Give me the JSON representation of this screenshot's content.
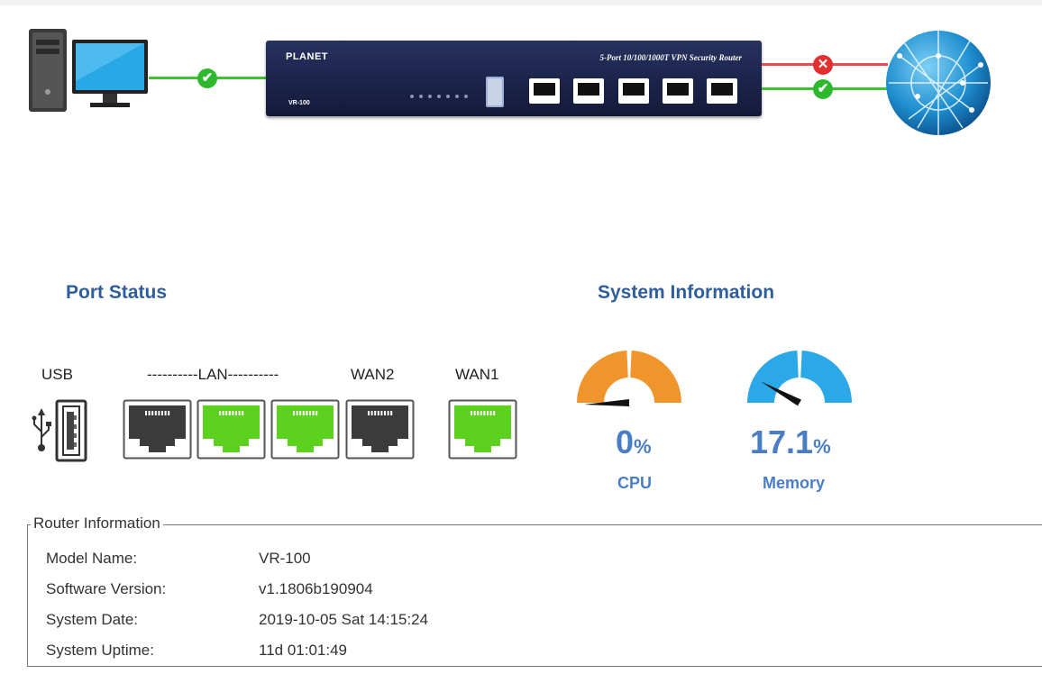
{
  "topology": {
    "router_brand": "PLANET",
    "router_tagline": "5-Port 10/100/1000T VPN Security Router",
    "router_model": "VR-100",
    "lan_link_status": "connected",
    "wan_links": [
      {
        "status": "disconnected"
      },
      {
        "status": "connected"
      }
    ],
    "colors": {
      "connected": "#2db82d",
      "disconnected": "#e03030",
      "line_ok": "#3ec234",
      "line_bad": "#e05050"
    }
  },
  "port_status": {
    "title": "Port Status",
    "usb_label": "USB",
    "lan_label": "----------LAN----------",
    "wan2_label": "WAN2",
    "wan1_label": "WAN1",
    "ports": [
      {
        "name": "lan-1",
        "state": "down"
      },
      {
        "name": "lan-2",
        "state": "up"
      },
      {
        "name": "lan-3",
        "state": "up"
      },
      {
        "name": "wan2",
        "state": "down"
      },
      {
        "name": "wan1",
        "state": "up"
      }
    ],
    "colors": {
      "up": "#5cd21e",
      "down": "#3b3b3b"
    }
  },
  "system_info": {
    "title": "System Information",
    "cpu": {
      "value": "0",
      "unit": "%",
      "label": "CPU",
      "fraction": 0.0,
      "color": "#f0952c"
    },
    "memory": {
      "value": "17.1",
      "unit": "%",
      "label": "Memory",
      "fraction": 0.171,
      "color": "#2aa8e8"
    }
  },
  "router_info": {
    "legend": "Router Information",
    "rows": [
      {
        "label": "Model Name:",
        "value": "VR-100"
      },
      {
        "label": "Software Version:",
        "value": "v1.1806b190904"
      },
      {
        "label": "System Date:",
        "value": "2019-10-05 Sat 14:15:24"
      },
      {
        "label": "System Uptime:",
        "value": "11d 01:01:49"
      }
    ]
  }
}
